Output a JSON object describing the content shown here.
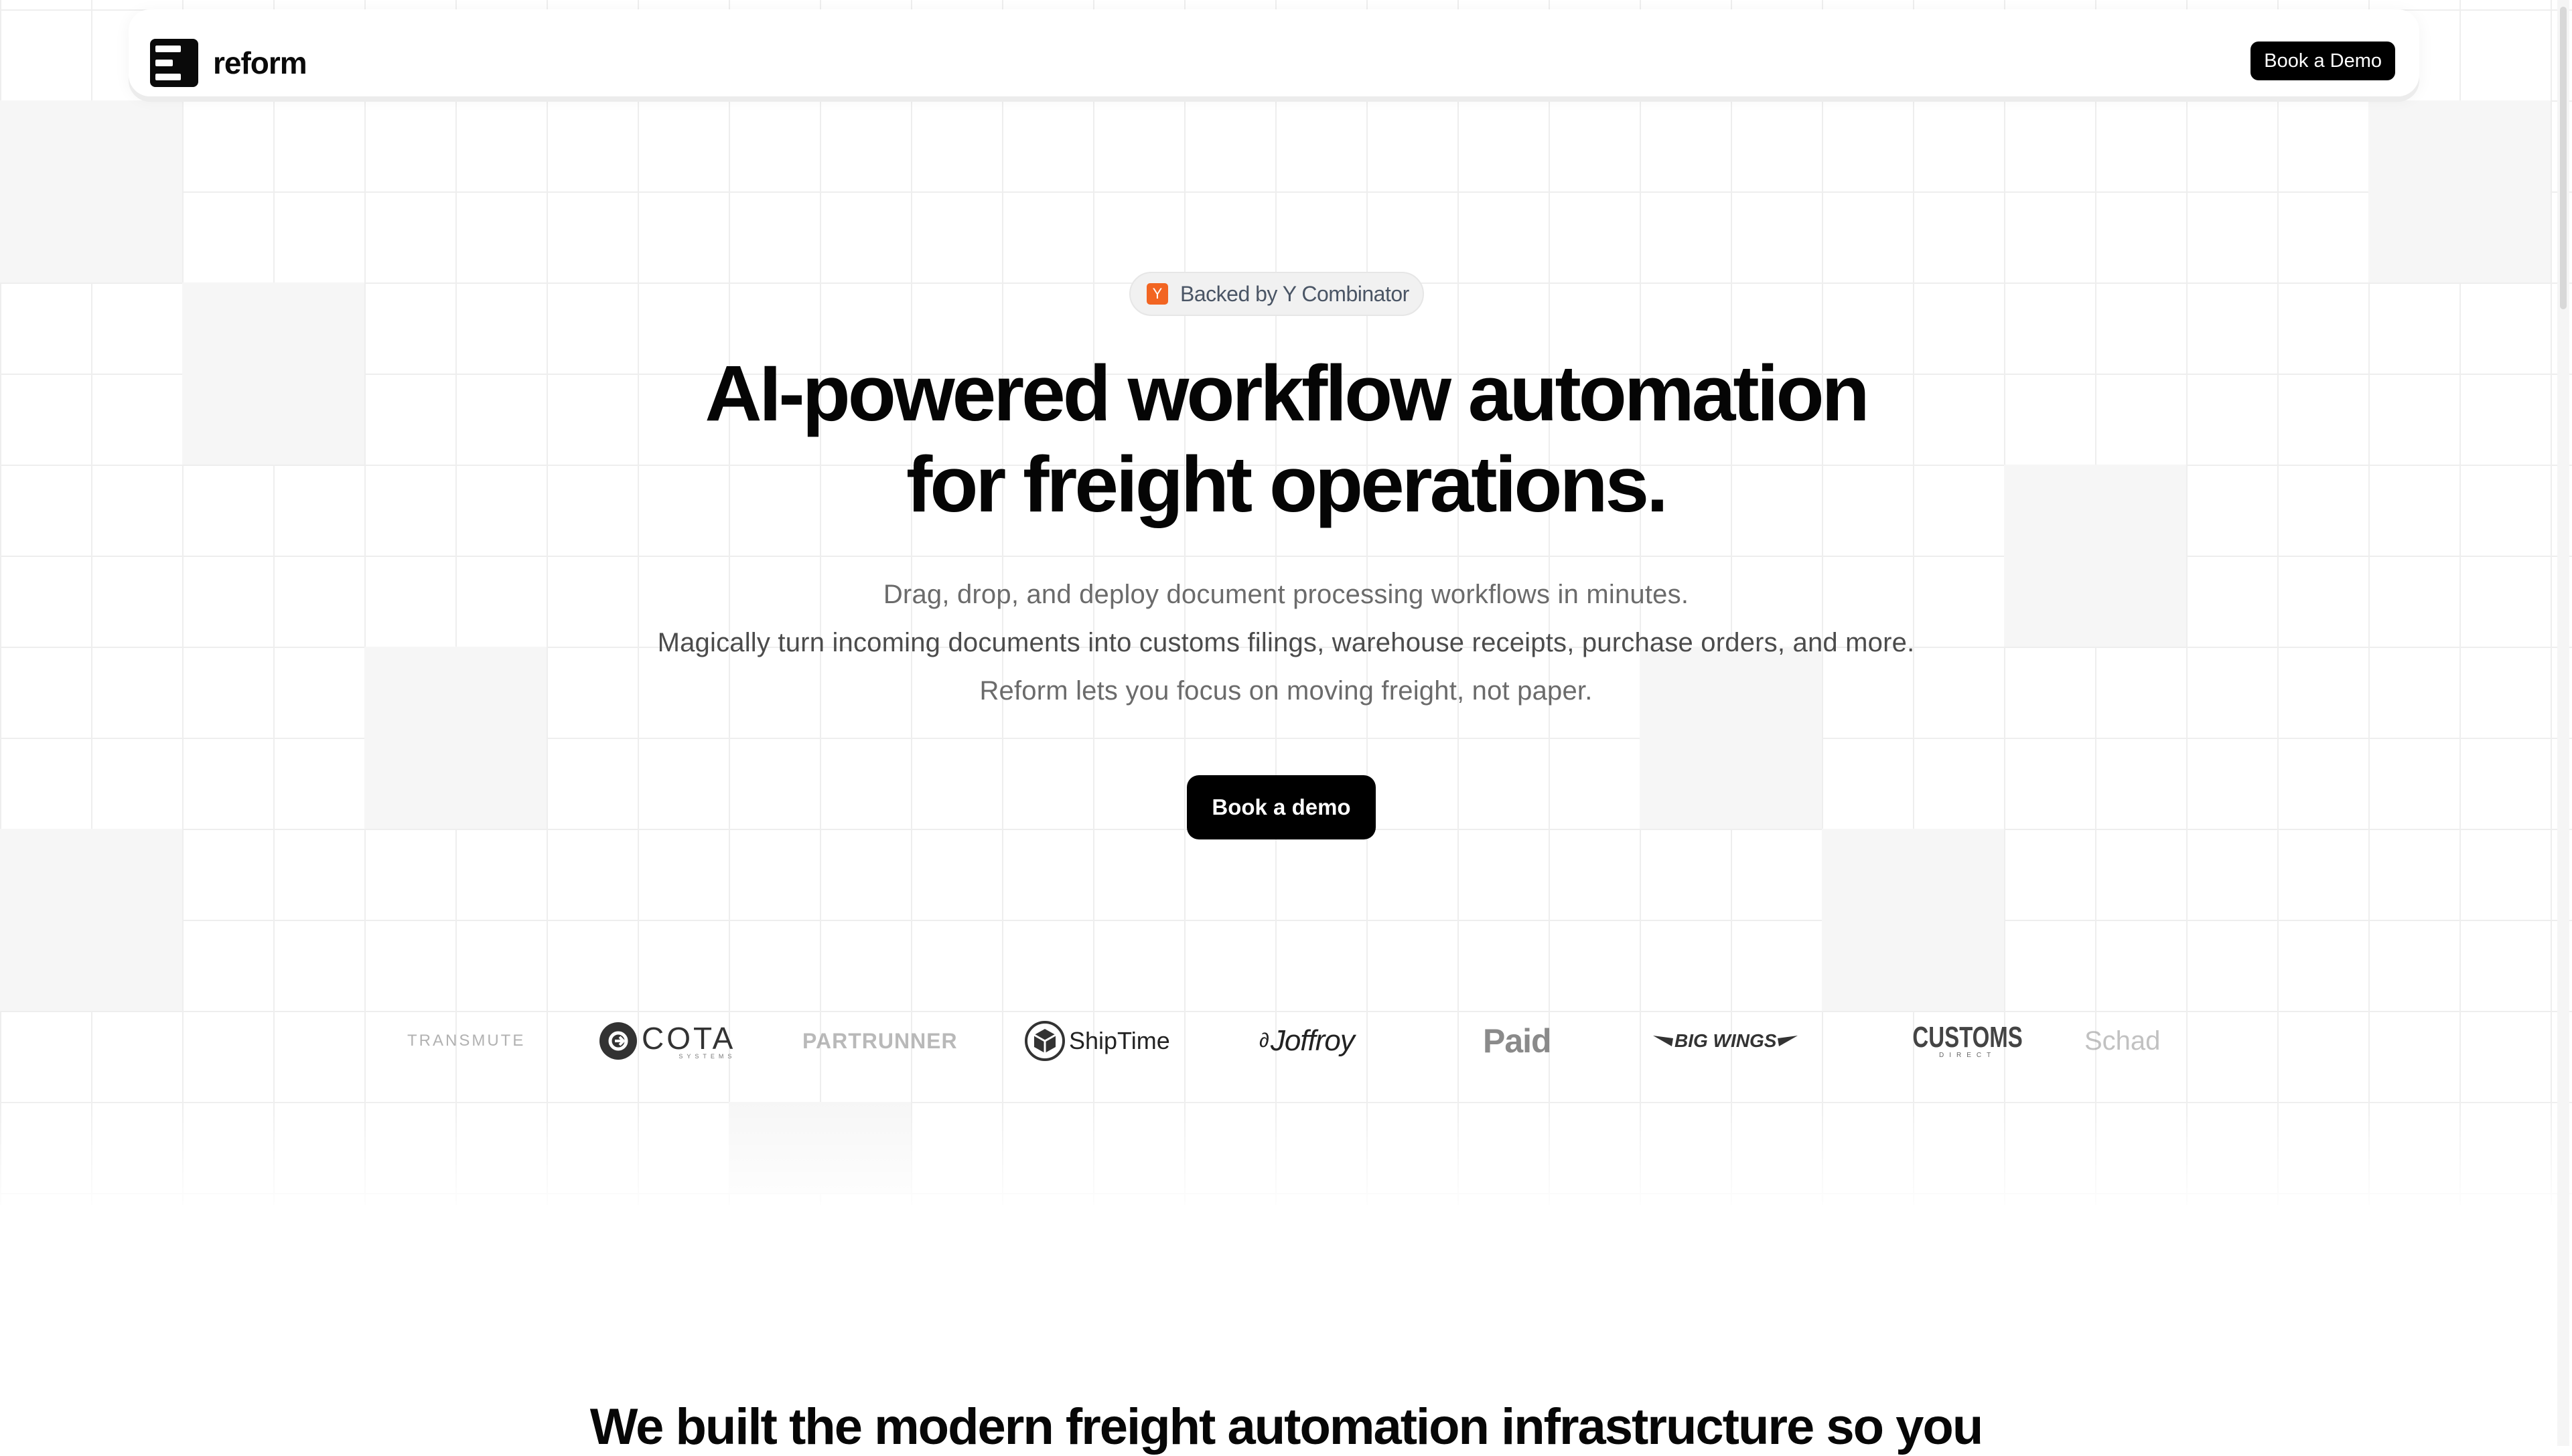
{
  "nav": {
    "brand": "reform",
    "cta_label": "Book a Demo"
  },
  "hero": {
    "badge_icon_letter": "Y",
    "badge_text": "Backed by Y Combinator",
    "title_line1": "AI-powered workflow automation",
    "title_line2": "for freight operations.",
    "subtitle_line1": "Drag, drop, and deploy document processing workflows in minutes.",
    "subtitle_line2": "Magically turn incoming documents into customs filings, warehouse receipts, purchase orders, and more.",
    "subtitle_line3": "Reform lets you focus on moving freight, not paper.",
    "cta_label": "Book a demo"
  },
  "logos": [
    {
      "name": "TRANSMUTE",
      "icon": "transmute-logo"
    },
    {
      "name": "COTA",
      "sub": "SYSTEMS",
      "icon": "cota-logo"
    },
    {
      "name": "PARTRUNNER",
      "icon": "partrunner-logo"
    },
    {
      "name": "ShipTime",
      "icon": "shiptime-logo"
    },
    {
      "name": "Joffroy",
      "icon": "joffroy-logo"
    },
    {
      "name": "Paid",
      "icon": "paid-logo"
    },
    {
      "name": "BIG WINGS",
      "icon": "big-wings-logo"
    },
    {
      "name": "CUSTOMS",
      "sub": "DIRECT",
      "icon": "customs-direct-logo"
    },
    {
      "name": "Schad",
      "icon": "schad-logo"
    }
  ],
  "section": {
    "heading": "We built the modern freight automation infrastructure so you"
  },
  "colors": {
    "primary": "#000000",
    "badge_bg": "#f1f1f1",
    "yc_orange": "#f26522",
    "text_muted": "#6b6b6b",
    "grid_line": "#eeeeee"
  }
}
